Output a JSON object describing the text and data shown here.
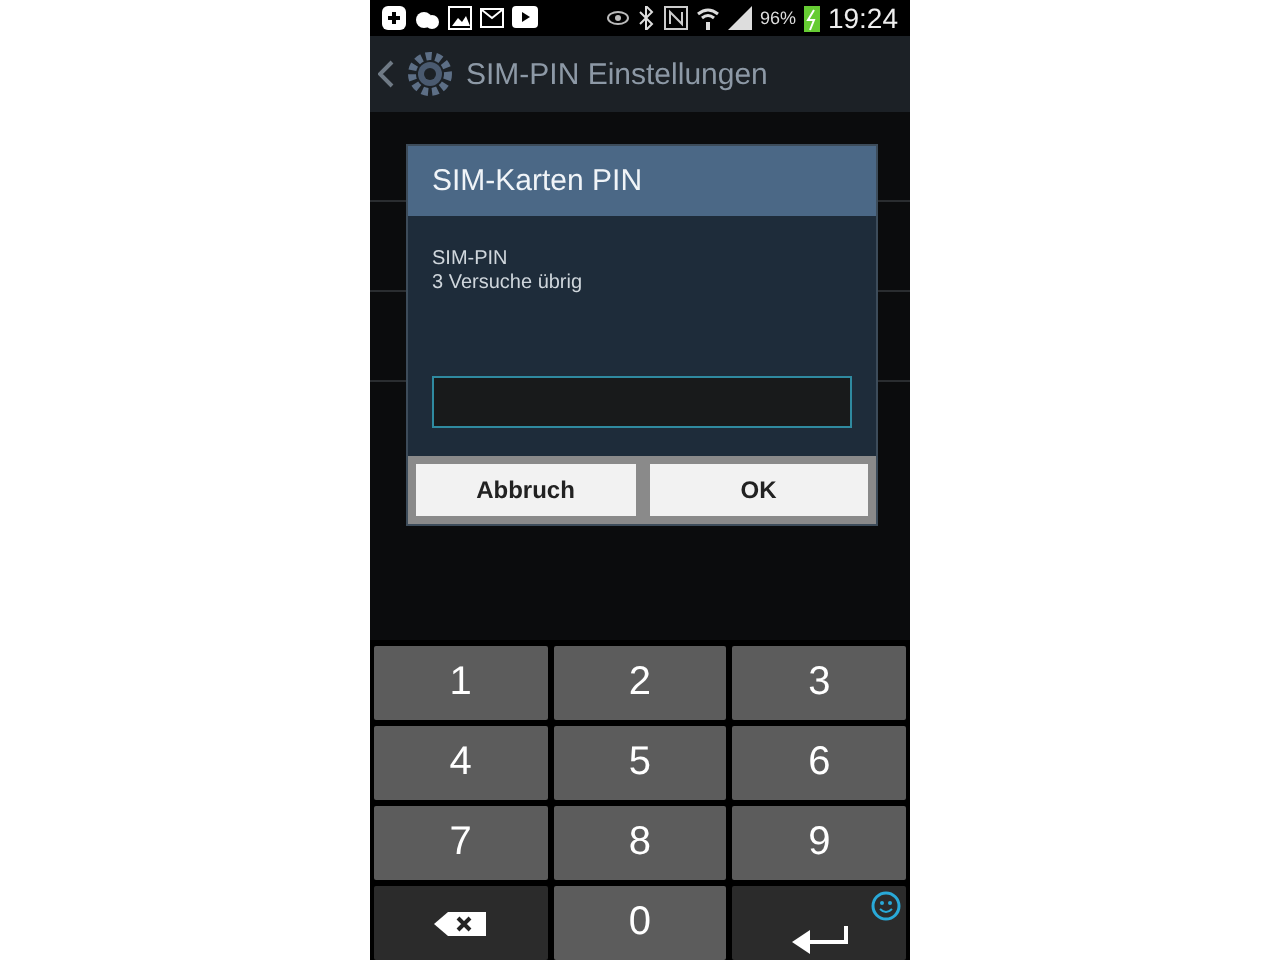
{
  "status_bar": {
    "battery": "96%",
    "time": "19:24"
  },
  "action_bar": {
    "title": "SIM-PIN Einstellungen"
  },
  "dialog": {
    "title": "SIM-Karten PIN",
    "message_lines": [
      "SIM-PIN",
      "3 Versuche übrig"
    ],
    "buttons": [
      "Abbruch",
      "OK"
    ]
  },
  "keypad": [
    {
      "kind": "digit",
      "label": "1"
    },
    {
      "kind": "digit",
      "label": "2"
    },
    {
      "kind": "digit",
      "label": "3"
    },
    {
      "kind": "digit",
      "label": "4"
    },
    {
      "kind": "digit",
      "label": "5"
    },
    {
      "kind": "digit",
      "label": "6"
    },
    {
      "kind": "digit",
      "label": "7"
    },
    {
      "kind": "digit",
      "label": "8"
    },
    {
      "kind": "digit",
      "label": "9"
    },
    {
      "kind": "backspace"
    },
    {
      "kind": "digit",
      "label": "0"
    },
    {
      "kind": "enter"
    }
  ]
}
